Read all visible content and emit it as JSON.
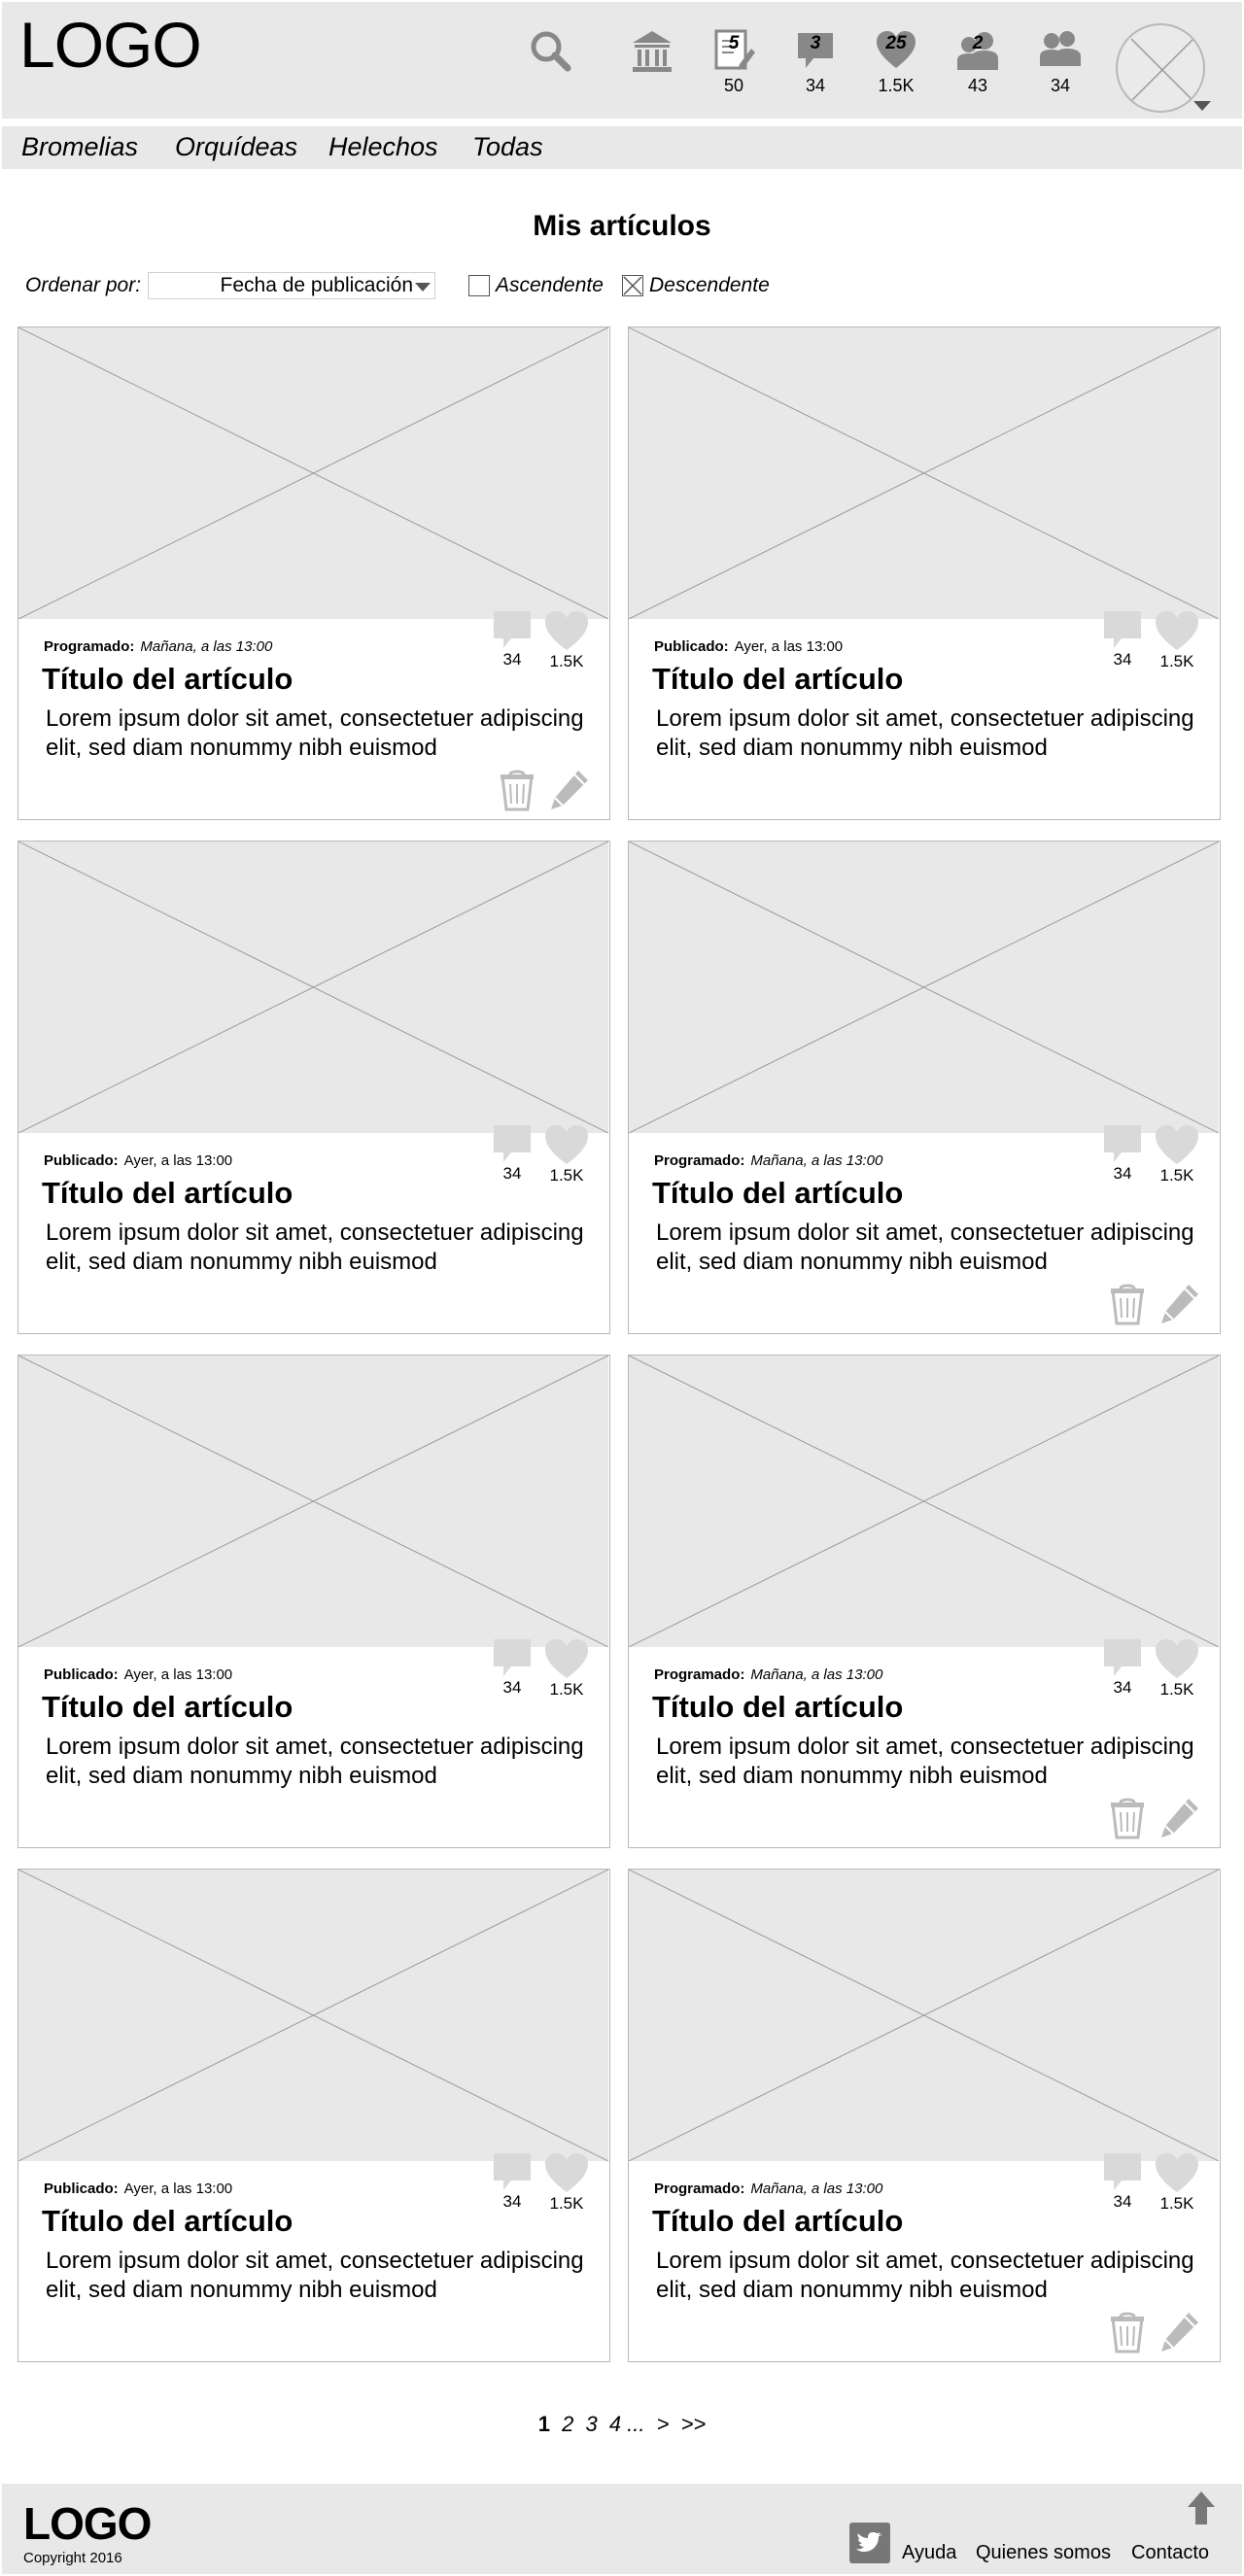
{
  "header": {
    "logo": "LOGO",
    "icons": [
      {
        "name": "search-icon"
      },
      {
        "name": "institution-icon"
      },
      {
        "name": "articles-edit-icon",
        "badge": "5",
        "count": "50"
      },
      {
        "name": "comments-icon",
        "badge": "3",
        "count": "34"
      },
      {
        "name": "likes-icon",
        "badge": "25",
        "count": "1.5K"
      },
      {
        "name": "followers-icon",
        "badge": "2",
        "count": "43"
      },
      {
        "name": "following-icon",
        "badge": "",
        "count": "34"
      }
    ]
  },
  "nav": {
    "items": [
      "Bromelias",
      "Orquídeas",
      "Helechos",
      "Todas"
    ]
  },
  "main": {
    "title": "Mis artículos",
    "sort": {
      "label": "Ordenar por:",
      "selected": "Fecha de publicación",
      "ascending_label": "Ascendente",
      "ascending_checked": false,
      "descending_label": "Descendente",
      "descending_checked": true
    }
  },
  "cards": [
    {
      "status_label": "Programado:",
      "status_time": "Mañana, a las 13:00",
      "title": "Título del artículo",
      "body": "Lorem ipsum dolor sit amet, consectetuer adipiscing elit, sed diam nonummy nibh euismod",
      "comments": "34",
      "likes": "1.5K",
      "editable": true
    },
    {
      "status_label": "Publicado:",
      "status_time": "Ayer, a las 13:00",
      "title": "Título del artículo",
      "body": "Lorem ipsum dolor sit amet, consectetuer adipiscing elit, sed diam nonummy nibh euismod",
      "comments": "34",
      "likes": "1.5K",
      "editable": false
    },
    {
      "status_label": "Publicado:",
      "status_time": "Ayer, a las 13:00",
      "title": "Título del artículo",
      "body": "Lorem ipsum dolor sit amet, consectetuer adipiscing elit, sed diam nonummy nibh euismod",
      "comments": "34",
      "likes": "1.5K",
      "editable": false
    },
    {
      "status_label": "Programado:",
      "status_time": "Mañana, a las 13:00",
      "title": "Título del artículo",
      "body": "Lorem ipsum dolor sit amet, consectetuer adipiscing elit, sed diam nonummy nibh euismod",
      "comments": "34",
      "likes": "1.5K",
      "editable": true
    },
    {
      "status_label": "Publicado:",
      "status_time": "Ayer, a las 13:00",
      "title": "Título del artículo",
      "body": "Lorem ipsum dolor sit amet, consectetuer adipiscing elit, sed diam nonummy nibh euismod",
      "comments": "34",
      "likes": "1.5K",
      "editable": false
    },
    {
      "status_label": "Programado:",
      "status_time": "Mañana, a las 13:00",
      "title": "Título del artículo",
      "body": "Lorem ipsum dolor sit amet, consectetuer adipiscing elit, sed diam nonummy nibh euismod",
      "comments": "34",
      "likes": "1.5K",
      "editable": true
    },
    {
      "status_label": "Publicado:",
      "status_time": "Ayer, a las 13:00",
      "title": "Título del artículo",
      "body": "Lorem ipsum dolor sit amet, consectetuer adipiscing elit, sed diam nonummy nibh euismod",
      "comments": "34",
      "likes": "1.5K",
      "editable": false
    },
    {
      "status_label": "Programado:",
      "status_time": "Mañana, a las 13:00",
      "title": "Título del artículo",
      "body": "Lorem ipsum dolor sit amet, consectetuer adipiscing elit, sed diam nonummy nibh euismod",
      "comments": "34",
      "likes": "1.5K",
      "editable": true
    }
  ],
  "pagination": {
    "pages": [
      "1",
      "2",
      "3",
      "4"
    ],
    "ellipsis": "...",
    "next": ">",
    "last": ">>"
  },
  "footer": {
    "logo": "LOGO",
    "copyright": "Copyright 2016",
    "links": [
      "Ayuda",
      "Quienes somos",
      "Contacto"
    ]
  },
  "colors": {
    "header_bg": "#e8e8e8",
    "placeholder": "#e8e8e8",
    "icon_gray": "#888888"
  }
}
